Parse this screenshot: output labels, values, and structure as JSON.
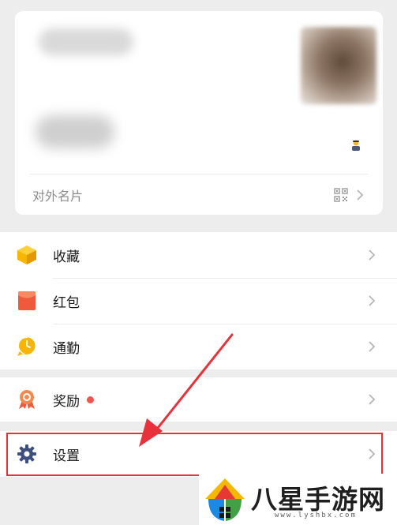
{
  "card": {
    "business_card_label": "对外名片"
  },
  "menu": {
    "group1": [
      {
        "label": "收藏",
        "icon": "favorites-cube-icon"
      },
      {
        "label": "红包",
        "icon": "red-envelope-icon"
      },
      {
        "label": "通勤",
        "icon": "commute-clock-icon"
      }
    ],
    "group2": [
      {
        "label": "奖励",
        "icon": "rewards-medal-icon",
        "badge": "red-dot"
      }
    ],
    "group3": [
      {
        "label": "设置",
        "icon": "settings-gear-icon"
      }
    ]
  },
  "watermark": {
    "title": "八星手游网",
    "url": "www.lyshbx.com"
  },
  "colors": {
    "accent_red": "#e8313a",
    "badge_red": "#f0564a",
    "favorites_yellow": "#f7b500",
    "envelope_red": "#f05a3c",
    "commute_yellow": "#f7b500",
    "settings_blue": "#3d5080"
  }
}
